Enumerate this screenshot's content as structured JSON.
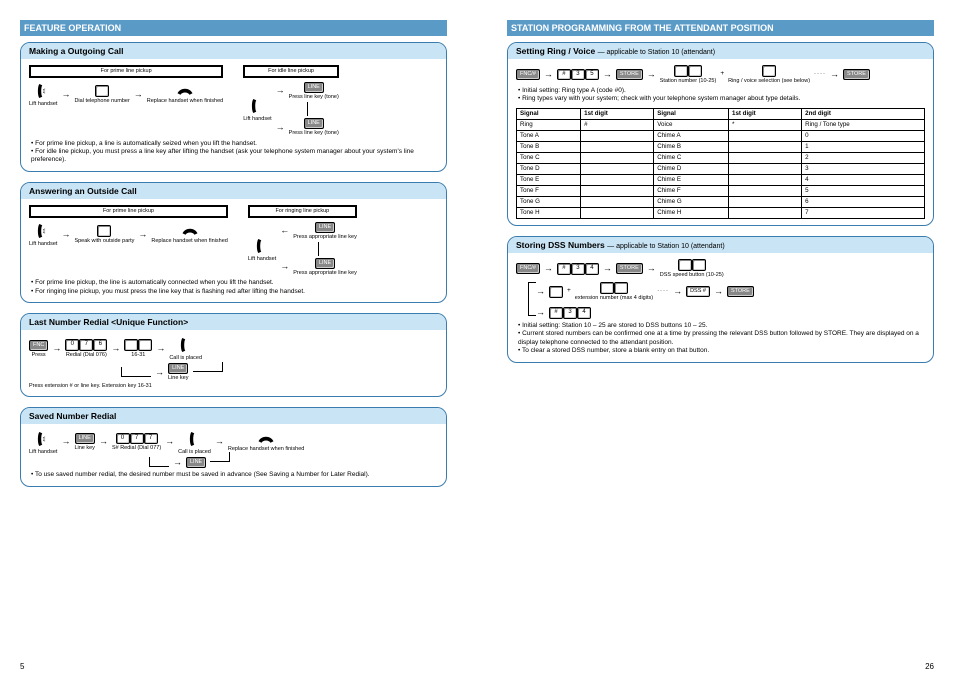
{
  "left": {
    "bar_title": "FEATURE OPERATION",
    "cards": [
      {
        "title": "Making a Outgoing Call",
        "sub": "",
        "frame1_title": "For prime line pickup",
        "frame2_title": "For idle line pickup",
        "lift_cap": "Lift handset",
        "dial_cap": "Dial telephone number",
        "replace_cap": "Replace handset when finished",
        "press_line_cap": "Press line key (tone)",
        "notes": [
          "For prime line pickup, a line is automatically seized when you lift the handset.",
          "For idle line pickup, you must press a line key after lifting the handset (ask your telephone system manager about your system's line preference)."
        ]
      },
      {
        "title": "Answering an Outside Call",
        "sub": "",
        "frame1_title": "For prime line pickup",
        "frame2_title": "For ringing line pickup",
        "lift_cap": "Lift handset",
        "speak_cap": "Speak with outside party",
        "replace_cap": "Replace handset when finished",
        "press_line_cap": "Press appropriate line key",
        "notes": [
          "For prime line pickup, the line is automatically connected when you lift the handset.",
          "For ringing line pickup, you must press the line key that is flashing red after lifting the handset."
        ]
      },
      {
        "title": "Last Number Redial <Unique Function>",
        "sub": "",
        "fnc_cap": "FNC",
        "redial_digits": "0 7 6",
        "ext_cap": "16-31",
        "line_cap": "Line key",
        "call_cap": "Call is placed",
        "redial_note": "Press extension # or line key. Extension key 16-31",
        "digits_label": "Redial (Dial 076)"
      },
      {
        "title": "Saved Number Redial",
        "sub": "",
        "lift_cap": "Lift handset",
        "line_cap": "Line key",
        "digits": "0 7 7",
        "digits_label": "S# Redial (Dial 077)",
        "call_cap": "Call is placed",
        "replace_cap": "Replace handset when finished",
        "note1": "To use saved number redial, the desired number must be saved in advance (See Saving a Number for Later Redial)."
      }
    ]
  },
  "right": {
    "bar_title": "STATION PROGRAMMING FROM THE ATTENDANT POSITION",
    "card1": {
      "title": "Setting Ring / Voice",
      "sub": "— applicable to Station 10 (attendant)",
      "fnc_cap": "FNC/#",
      "d1": "#",
      "d2": "3",
      "d3": "5",
      "store1_cap": "STORE",
      "nn_cap": "Station number (10-25)",
      "plus": "+",
      "x_cap": "Ring / voice selection (see below)",
      "dots": "····",
      "store2_cap": "STORE",
      "notes": [
        "Initial setting: Ring type A (code #0).",
        "Ring types vary with your system; check with your telephone system manager about type details."
      ],
      "table": {
        "headers": [
          "Signal",
          "1st digit",
          "Signal",
          "1st digit",
          "2nd digit"
        ],
        "rows": [
          [
            "Ring",
            "#",
            "Voice",
            "*",
            "Ring / Tone type"
          ],
          [
            "Tone A",
            "",
            "Chime A",
            "",
            "0"
          ],
          [
            "Tone B",
            "",
            "Chime B",
            "",
            "1"
          ],
          [
            "Tone C",
            "",
            "Chime C",
            "",
            "2"
          ],
          [
            "Tone D",
            "",
            "Chime D",
            "",
            "3"
          ],
          [
            "Tone E",
            "",
            "Chime E",
            "",
            "4"
          ],
          [
            "Tone F",
            "",
            "Chime F",
            "",
            "5"
          ],
          [
            "Tone G",
            "",
            "Chime G",
            "",
            "6"
          ],
          [
            "Tone H",
            "",
            "Chime H",
            "",
            "7"
          ]
        ]
      }
    },
    "card2": {
      "title": "Storing DSS Numbers",
      "sub": "— applicable to Station 10 (attendant)",
      "fnc_cap": "FNC/#",
      "d1": "#",
      "d2": "3",
      "d3": "4",
      "store1_cap": "STORE",
      "nn_cap": "DSS speed button (10-25)",
      "plus": "+",
      "ext_cap": "extension number (max 4 digits)",
      "dots": "····",
      "dss_cap": "DSS #",
      "store2_cap": "STORE",
      "digits2": "# 3 4",
      "notes": [
        "Initial setting: Station 10 – 25 are stored to DSS buttons 10 – 25.",
        "Current stored numbers can be confirmed one at a time by pressing the relevant DSS button followed by STORE. They are displayed on a display telephone connected to the attendant position.",
        "To clear a stored DSS number, store a blank entry on that button."
      ]
    }
  },
  "page_left": "5",
  "page_right": "26"
}
